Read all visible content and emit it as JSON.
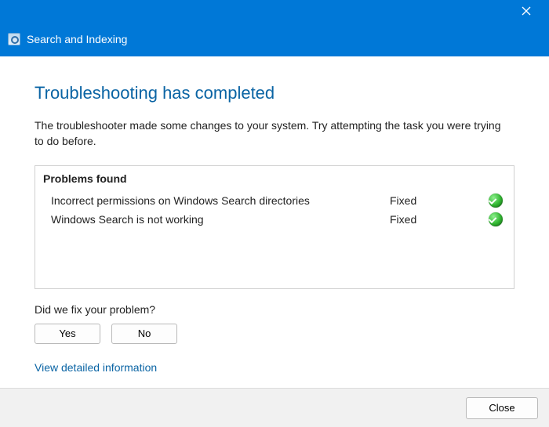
{
  "titlebar": {
    "app_title": "Search and Indexing"
  },
  "main": {
    "heading": "Troubleshooting has completed",
    "subtext": "The troubleshooter made some changes to your system. Try attempting the task you were trying to do before."
  },
  "problems": {
    "header": "Problems found",
    "items": [
      {
        "description": "Incorrect permissions on Windows Search directories",
        "status": "Fixed",
        "icon": "check"
      },
      {
        "description": "Windows Search is not working",
        "status": "Fixed",
        "icon": "check"
      }
    ]
  },
  "feedback": {
    "question": "Did we fix your problem?",
    "yes_label": "Yes",
    "no_label": "No"
  },
  "links": {
    "view_details": "View detailed information"
  },
  "footer": {
    "close_label": "Close"
  }
}
